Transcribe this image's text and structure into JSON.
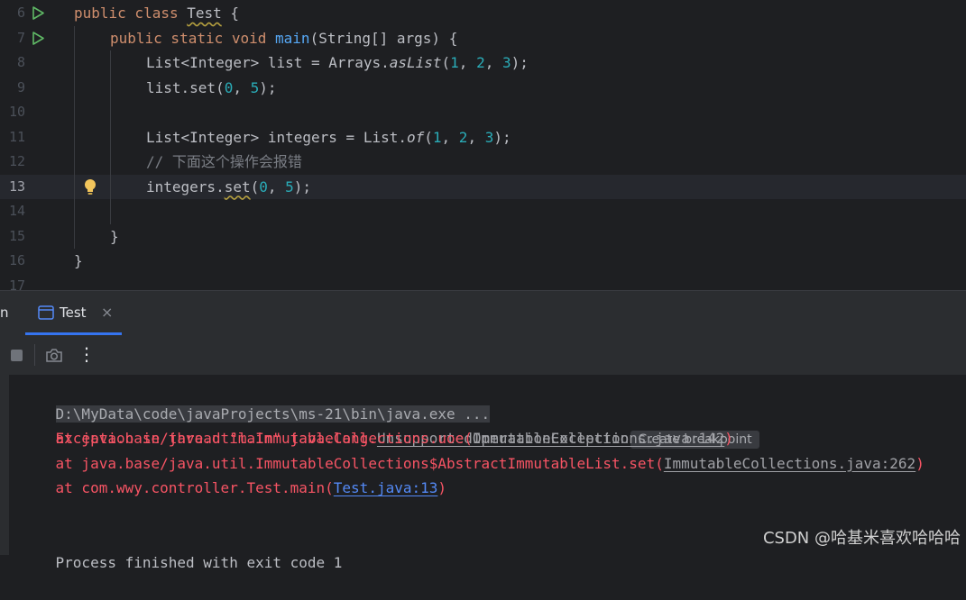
{
  "editor": {
    "current_line": 13,
    "lines": [
      {
        "num": "6",
        "run": true,
        "indent": 0,
        "tokens": [
          [
            "kw",
            "public class "
          ],
          [
            "warn",
            "Test"
          ],
          [
            "plain",
            " {"
          ]
        ]
      },
      {
        "num": "7",
        "run": true,
        "indent": 1,
        "tokens": [
          [
            "kw",
            "public static void "
          ],
          [
            "fn",
            "main"
          ],
          [
            "plain",
            "(String[] args) {"
          ]
        ]
      },
      {
        "num": "8",
        "indent": 2,
        "tokens": [
          [
            "plain",
            "List<Integer> list = Arrays."
          ],
          [
            "static",
            "asList"
          ],
          [
            "plain",
            "("
          ],
          [
            "num",
            "1"
          ],
          [
            "plain",
            ", "
          ],
          [
            "num",
            "2"
          ],
          [
            "plain",
            ", "
          ],
          [
            "num",
            "3"
          ],
          [
            "plain",
            ");"
          ]
        ]
      },
      {
        "num": "9",
        "indent": 2,
        "tokens": [
          [
            "plain",
            "list.set("
          ],
          [
            "num",
            "0"
          ],
          [
            "plain",
            ", "
          ],
          [
            "num",
            "5"
          ],
          [
            "plain",
            ");"
          ]
        ]
      },
      {
        "num": "10",
        "indent": 0,
        "tokens": []
      },
      {
        "num": "11",
        "indent": 2,
        "tokens": [
          [
            "plain",
            "List<Integer> integers = List."
          ],
          [
            "static",
            "of"
          ],
          [
            "plain",
            "("
          ],
          [
            "num",
            "1"
          ],
          [
            "plain",
            ", "
          ],
          [
            "num",
            "2"
          ],
          [
            "plain",
            ", "
          ],
          [
            "num",
            "3"
          ],
          [
            "plain",
            ");"
          ]
        ]
      },
      {
        "num": "12",
        "indent": 2,
        "tokens": [
          [
            "comment",
            "// 下面这个操作会报错"
          ]
        ]
      },
      {
        "num": "13",
        "indent": 2,
        "bulb": true,
        "tokens": [
          [
            "plain",
            "integers."
          ],
          [
            "warn",
            "set"
          ],
          [
            "plain",
            "("
          ],
          [
            "num",
            "0"
          ],
          [
            "plain",
            ", "
          ],
          [
            "num",
            "5"
          ],
          [
            "plain",
            ");"
          ]
        ]
      },
      {
        "num": "14",
        "indent": 0,
        "tokens": []
      },
      {
        "num": "15",
        "indent": 1,
        "tokens": [
          [
            "plain",
            "}"
          ]
        ]
      },
      {
        "num": "16",
        "indent": 0,
        "tokens": [
          [
            "plain",
            "}"
          ]
        ]
      },
      {
        "num": "17",
        "indent": 0,
        "tokens": []
      }
    ]
  },
  "run_panel": {
    "left_stub": "n",
    "tab_label": "Test",
    "tab_close": "×"
  },
  "toolbar": {
    "icons": [
      "stop-icon",
      "camera-icon",
      "more-icon"
    ],
    "more_glyph": "⋮"
  },
  "console": {
    "command": "D:\\MyData\\code\\javaProjects\\ms-21\\bin\\java.exe ...",
    "exception_prefix": "Exception in thread \"main\" java.lang.",
    "exception_class": "UnsupportedOperationException",
    "create_breakpoint": "Create breakpoint",
    "trace": [
      {
        "prefix": "    at java.base/java.util.ImmutableCollections.uoe(",
        "link": "ImmutableCollections.java:142",
        "suffix": ")",
        "link_style": "grey"
      },
      {
        "prefix": "    at java.base/java.util.ImmutableCollections$AbstractImmutableList.set(",
        "link": "ImmutableCollections.java:262",
        "suffix": ")",
        "link_style": "grey"
      },
      {
        "prefix": "    at com.wwy.controller.Test.main(",
        "link": "Test.java:13",
        "suffix": ")",
        "link_style": "blue"
      }
    ],
    "exit_message": "Process finished with exit code 1"
  },
  "watermark": "CSDN @哈基米喜欢哈哈哈",
  "colors": {
    "background": "#1e1f22",
    "keyword": "#cf8e6d",
    "function": "#56a8f5",
    "number": "#2aacb8",
    "error": "#f75464",
    "link": "#548af7",
    "run_icon": "#5fb865",
    "accent": "#3574f0"
  }
}
